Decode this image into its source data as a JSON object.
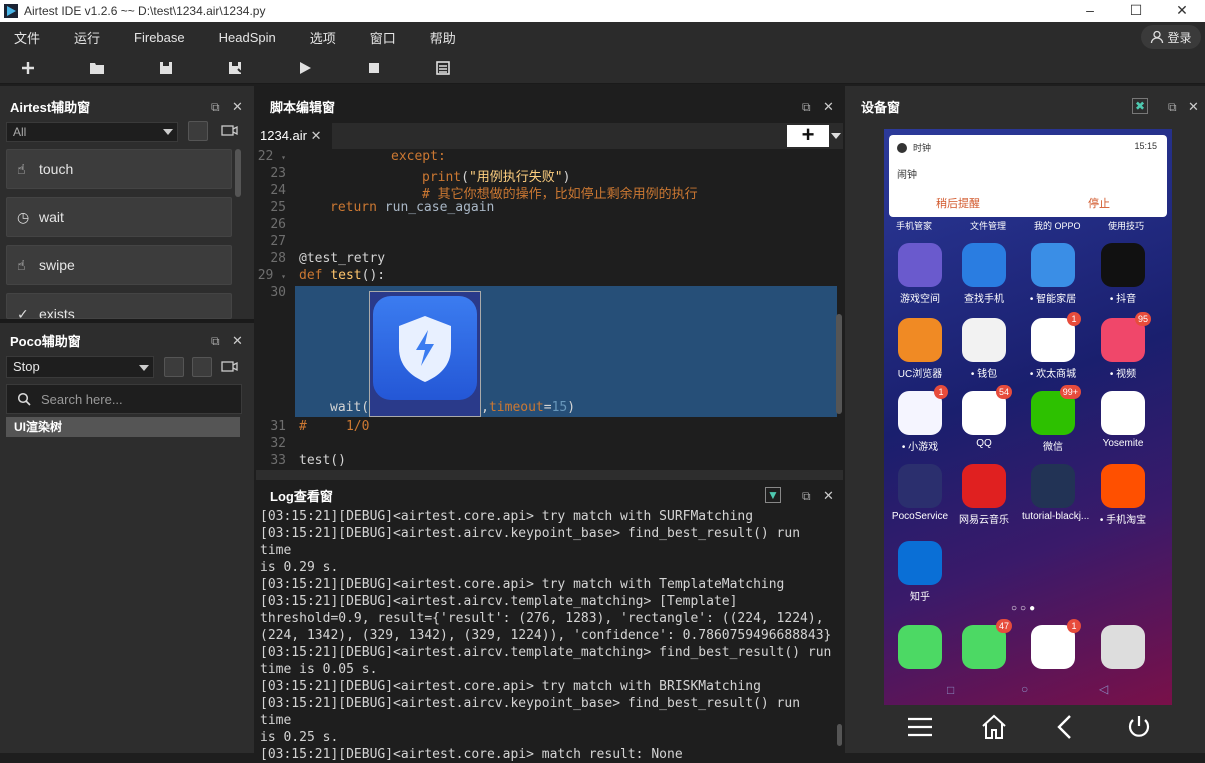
{
  "title": "Airtest IDE v1.2.6 ~~ D:\\test\\1234.air\\1234.py",
  "menu": [
    "文件",
    "运行",
    "Firebase",
    "HeadSpin",
    "选项",
    "窗口",
    "帮助"
  ],
  "login": "登录",
  "airtest_panel": {
    "title": "Airtest辅助窗",
    "filter": "All",
    "actions": [
      "touch",
      "wait",
      "swipe",
      "exists"
    ]
  },
  "poco_panel": {
    "title": "Poco辅助窗",
    "mode": "Stop",
    "search_placeholder": "Search here...",
    "tree_root": "UI渲染树"
  },
  "editor": {
    "title": "脚本编辑窗",
    "tab": "1234.air",
    "lines": [
      {
        "n": "22",
        "fold": true,
        "text": "except:"
      },
      {
        "n": "23",
        "text": "print(\"用例执行失败\")"
      },
      {
        "n": "24",
        "text": "# 其它你想做的操作，比如停止剩余用例的执行"
      },
      {
        "n": "25",
        "text": "return run_case_again"
      },
      {
        "n": "26",
        "text": ""
      },
      {
        "n": "27",
        "text": ""
      },
      {
        "n": "28",
        "text": "@test_retry"
      },
      {
        "n": "29",
        "fold": true,
        "text": "def test():"
      },
      {
        "n": "30",
        "text": "wait(",
        "suffix": ",timeout=15)"
      },
      {
        "n": "31",
        "text": "#     1/0"
      },
      {
        "n": "32",
        "text": ""
      },
      {
        "n": "33",
        "text": "test()"
      }
    ]
  },
  "log": {
    "title": "Log查看窗",
    "lines": [
      "[03:15:21][DEBUG]<airtest.core.api> try match with SURFMatching",
      "[03:15:21][DEBUG]<airtest.aircv.keypoint_base> find_best_result() run time",
      "is 0.29 s.",
      "[03:15:21][DEBUG]<airtest.core.api> try match with TemplateMatching",
      "[03:15:21][DEBUG]<airtest.aircv.template_matching> [Template]",
      "threshold=0.9, result={'result': (276, 1283), 'rectangle': ((224, 1224),",
      "(224, 1342), (329, 1342), (329, 1224)), 'confidence': 0.7860759496688843}",
      "[03:15:21][DEBUG]<airtest.aircv.template_matching> find_best_result() run",
      "time is 0.05 s.",
      "[03:15:21][DEBUG]<airtest.core.api> try match with BRISKMatching",
      "[03:15:21][DEBUG]<airtest.aircv.keypoint_base> find_best_result() run time",
      "is 0.25 s.",
      "[03:15:21][DEBUG]<airtest.core.api> match result: None"
    ]
  },
  "device": {
    "title": "设备窗",
    "notification": {
      "app": "时钟",
      "time": "15:15",
      "body": "闹钟",
      "snooze": "稍后提醒",
      "stop": "停止"
    },
    "top_row": [
      "手机管家",
      "文件管理",
      "我的 OPPO",
      "使用技巧"
    ],
    "apps": [
      {
        "label": "游戏空间",
        "color": "#6a5acd"
      },
      {
        "label": "查找手机",
        "color": "#2a7de1"
      },
      {
        "label": "• 智能家居",
        "color": "#3a8ee6"
      },
      {
        "label": "• 抖音",
        "color": "#111111"
      },
      {
        "label": "UC浏览器",
        "color": "#f08a24"
      },
      {
        "label": "• 钱包",
        "color": "#f2f2f2"
      },
      {
        "label": "• 欢太商城",
        "color": "#ffffff",
        "badge": "1"
      },
      {
        "label": "• 视频",
        "color": "#f0476a",
        "badge": "95"
      },
      {
        "label": "• 小游戏",
        "color": "#f5f5ff",
        "badge": "1"
      },
      {
        "label": "QQ",
        "color": "#ffffff",
        "badge": "54"
      },
      {
        "label": "微信",
        "color": "#2dc100",
        "badge": "99+"
      },
      {
        "label": "Yosemite",
        "color": "#ffffff"
      },
      {
        "label": "PocoService",
        "color": "#2b2f6e"
      },
      {
        "label": "网易云音乐",
        "color": "#e02020"
      },
      {
        "label": "tutorial-blackj...",
        "color": "#223355"
      },
      {
        "label": "• 手机淘宝",
        "color": "#ff5000"
      },
      {
        "label": "知乎",
        "color": "#0a6fd6"
      }
    ],
    "dock": [
      {
        "color": "#4cd964"
      },
      {
        "color": "#4cd964",
        "badge": "47"
      },
      {
        "color": "#ffffff",
        "badge": "1"
      },
      {
        "color": "#dddddd"
      }
    ]
  }
}
